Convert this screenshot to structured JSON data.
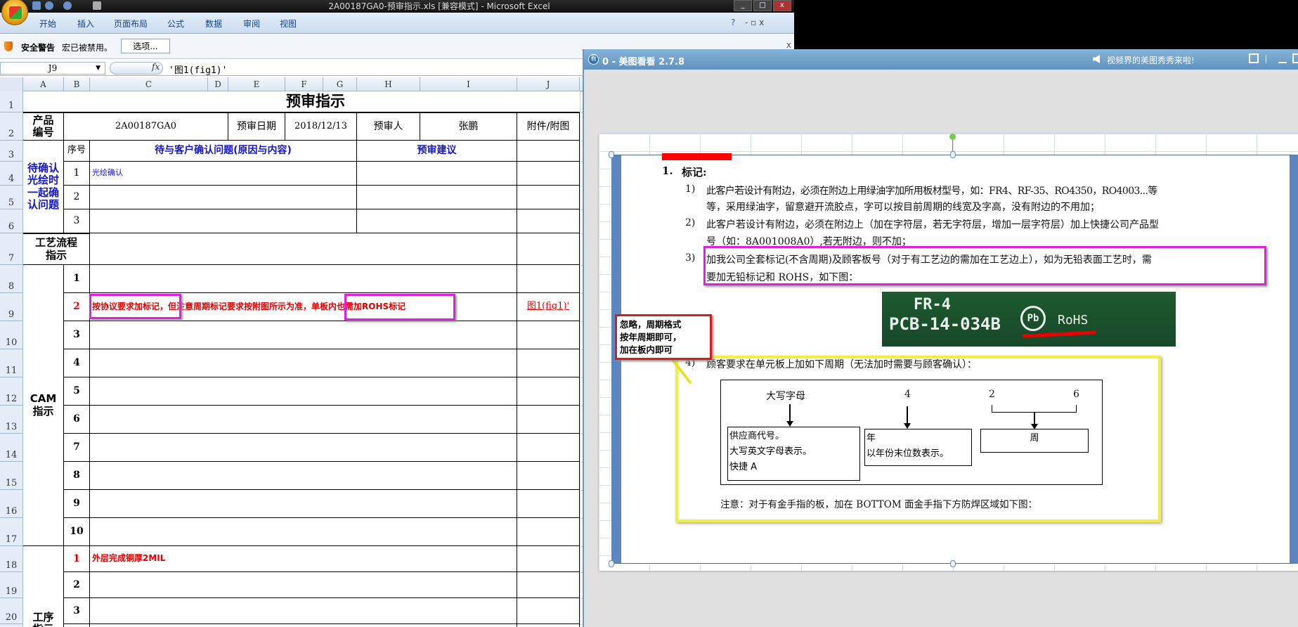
{
  "excel": {
    "title": "2A00187GA0-预审指示.xls  [兼容模式] - Microsoft Excel",
    "tabs": [
      "开始",
      "插入",
      "页面布局",
      "公式",
      "数据",
      "审阅",
      "视图"
    ],
    "security": {
      "label": "安全警告",
      "message": "宏已被禁用。",
      "options_button": "选项..."
    },
    "name_box": "J9",
    "fx_label": "fx",
    "formula": "'图1(fig1)'",
    "columns": [
      "A",
      "B",
      "C",
      "D",
      "E",
      "F",
      "G",
      "H",
      "I",
      "J"
    ],
    "rows": [
      "1",
      "2",
      "3",
      "4",
      "5",
      "6",
      "7",
      "8",
      "9",
      "10",
      "11",
      "12",
      "13",
      "14",
      "15",
      "16",
      "17",
      "18",
      "19",
      "20"
    ],
    "sheet": {
      "title": "预审指示",
      "product_no_label": "产品编号",
      "product_no": "2A00187GA0",
      "date_label": "预审日期",
      "date": "2018/12/13",
      "reviewer_label": "预审人",
      "reviewer": "张鹏",
      "attach_label": "附件/附图",
      "confirm_section": "待确认光绘时一起确认问题",
      "seq_label": "序号",
      "question_header": "待与客户确认问题(原因与内容)",
      "suggest_header": "预审建议",
      "confirm_items": [
        {
          "n": "1",
          "text": "光绘确认"
        },
        {
          "n": "2",
          "text": ""
        },
        {
          "n": "3",
          "text": ""
        }
      ],
      "flow_label": "工艺流程指示",
      "cam_label": "CAM指示",
      "cam_items": [
        {
          "n": "1",
          "text": ""
        },
        {
          "n": "2",
          "text_a": "按协议要求加标记，",
          "text_b": "但注意周期标记要求按附图所示为准，",
          "text_c": "单板内也需加ROHS标记",
          "link": "图1(fig1)'"
        },
        {
          "n": "3"
        },
        {
          "n": "4"
        },
        {
          "n": "5"
        },
        {
          "n": "6"
        },
        {
          "n": "7"
        },
        {
          "n": "8"
        },
        {
          "n": "9"
        },
        {
          "n": "10"
        }
      ],
      "process_label": "工序指示",
      "process_items": [
        {
          "n": "1",
          "text": "外层完成铜厚2MIL"
        },
        {
          "n": "2"
        },
        {
          "n": "3"
        }
      ]
    }
  },
  "viewer": {
    "title": "0 - 美图看看 2.7.8",
    "promo": "视频界的美图秀秀来啦!",
    "doc": {
      "heading": "1.",
      "heading_text": "标记:",
      "items": [
        {
          "num": "1)",
          "lines": [
            "此客户若设计有附边，必须在附边上用绿油字加所用板材型号，如：FR4、RF-35、RO4350，RO4003...等",
            "等，采用绿油字，留意避开流胶点，字可以按目前周期的线宽及字高，没有附边的不用加；"
          ]
        },
        {
          "num": "2)",
          "lines": [
            "此客户若设计有附边，必须在附边上（加在字符层，若无字符层，增加一层字符层）加上快捷公司产品型",
            "号（如：8A001008A0）,若无附边，则不加；"
          ]
        },
        {
          "num": "3)",
          "lines": [
            "加我公司全套标记(不含周期)及顾客板号（对于有工艺边的需加在工艺边上），如为无铅表面工艺时，需",
            "要加无铅标记和 ROHS，如下图："
          ]
        },
        {
          "num": "4)",
          "lines": [
            "顾客要求在单元板上加如下周期（无法加时需要与顾客确认）："
          ]
        }
      ],
      "pcb": {
        "line1": "FR-4",
        "line2": "PCB-14-034B",
        "pb": "Pb",
        "rohs": "RoHS"
      },
      "callout": [
        "忽略，周期格式",
        "按年周期即可，",
        "加在板内即可"
      ],
      "diagram": {
        "label1": "大写字母",
        "label2": "4",
        "label3a": "2",
        "label3b": "6",
        "box1": [
          "供应商代号。",
          "大写英文字母表示。",
          "快捷  A"
        ],
        "box2": [
          "年",
          "以年份末位数表示。"
        ],
        "box3": "周"
      },
      "note": "注意：对于有金手指的板，加在 BOTTOM 面金手指下方防焊区域如下图：",
      "colors": {
        "magenta": "#e020e0",
        "yellow": "#f0f040",
        "red": "#d02020"
      }
    }
  }
}
